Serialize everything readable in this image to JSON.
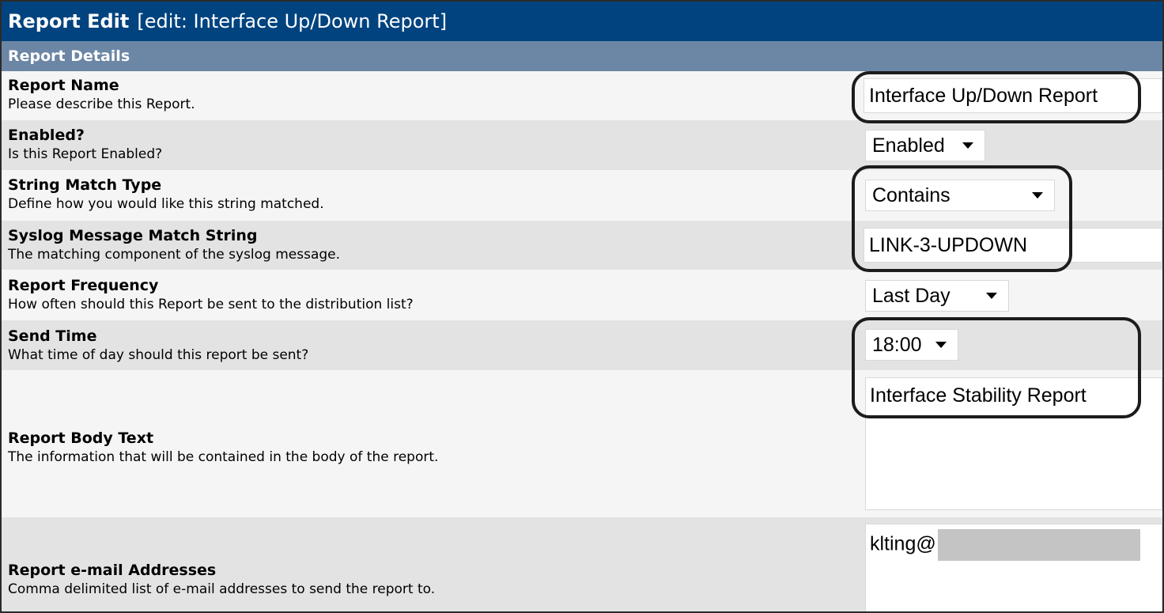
{
  "header": {
    "title": "Report Edit",
    "subtitle": "[edit: Interface Up/Down Report]"
  },
  "section": {
    "title": "Report Details"
  },
  "fields": {
    "report_name": {
      "label": "Report Name",
      "description": "Please describe this Report.",
      "value": "Interface Up/Down Report"
    },
    "enabled": {
      "label": "Enabled?",
      "description": "Is this Report Enabled?",
      "value": "Enabled"
    },
    "string_match_type": {
      "label": "String Match Type",
      "description": "Define how you would like this string matched.",
      "value": "Contains"
    },
    "match_string": {
      "label": "Syslog Message Match String",
      "description": "The matching component of the syslog message.",
      "value": "LINK-3-UPDOWN"
    },
    "report_frequency": {
      "label": "Report Frequency",
      "description": "How often should this Report be sent to the distribution list?",
      "value": "Last Day"
    },
    "send_time": {
      "label": "Send Time",
      "description": "What time of day should this report be sent?",
      "value": "18:00"
    },
    "body_text": {
      "label": "Report Body Text",
      "description": "The information that will be contained in the body of the report.",
      "value": "Interface Stability Report"
    },
    "email_addresses": {
      "label": "Report e-mail Addresses",
      "description": "Comma delimited list of e-mail addresses to send the report to.",
      "value_visible": "klting@"
    }
  },
  "icons": {
    "dropdown": "chevron-down-icon"
  }
}
